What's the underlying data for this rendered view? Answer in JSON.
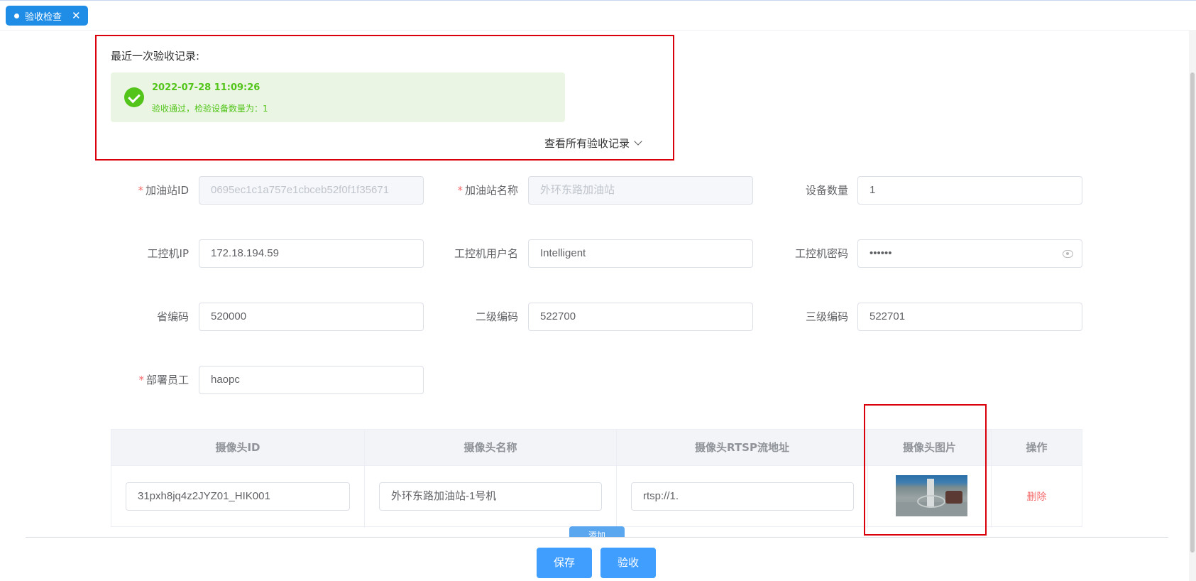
{
  "tabs": [
    {
      "label": "验收检查"
    }
  ],
  "record": {
    "title": "最近一次验收记录:",
    "time": "2022-07-28 11:09:26",
    "description": "验收通过，检验设备数量为：1",
    "view_all": "查看所有验收记录"
  },
  "form": {
    "station_id": {
      "label": "加油站ID",
      "value": "0695ec1c1a757e1cbceb52f0f1f35671",
      "required": true
    },
    "station_name": {
      "label": "加油站名称",
      "value": "外环东路加油站",
      "required": true
    },
    "device_count": {
      "label": "设备数量",
      "value": "1"
    },
    "ipc_ip": {
      "label": "工控机IP",
      "value": "172.18.194.59"
    },
    "ipc_user": {
      "label": "工控机用户名",
      "value": "Intelligent"
    },
    "ipc_password": {
      "label": "工控机密码",
      "value": "••••••"
    },
    "province_code": {
      "label": "省编码",
      "value": "520000"
    },
    "level2_code": {
      "label": "二级编码",
      "value": "522700"
    },
    "level3_code": {
      "label": "三级编码",
      "value": "522701"
    },
    "staff": {
      "label": "部署员工",
      "value": "haopc",
      "required": true
    }
  },
  "required_mark": "*",
  "table": {
    "headers": [
      "摄像头ID",
      "摄像头名称",
      "摄像头RTSP流地址",
      "摄像头图片",
      "操作"
    ],
    "rows": [
      {
        "id": "31pxh8jq4z2JYZ01_HIK001",
        "name": "外环东路加油站-1号机",
        "rtsp": "rtsp://1.",
        "delete": "删除"
      }
    ]
  },
  "buttons": {
    "add": "添加",
    "save": "保存",
    "accept": "验收"
  },
  "colors": {
    "primary": "#409eff",
    "success": "#52c41a",
    "danger": "#f56c6c",
    "highlight": "#d9000b"
  }
}
